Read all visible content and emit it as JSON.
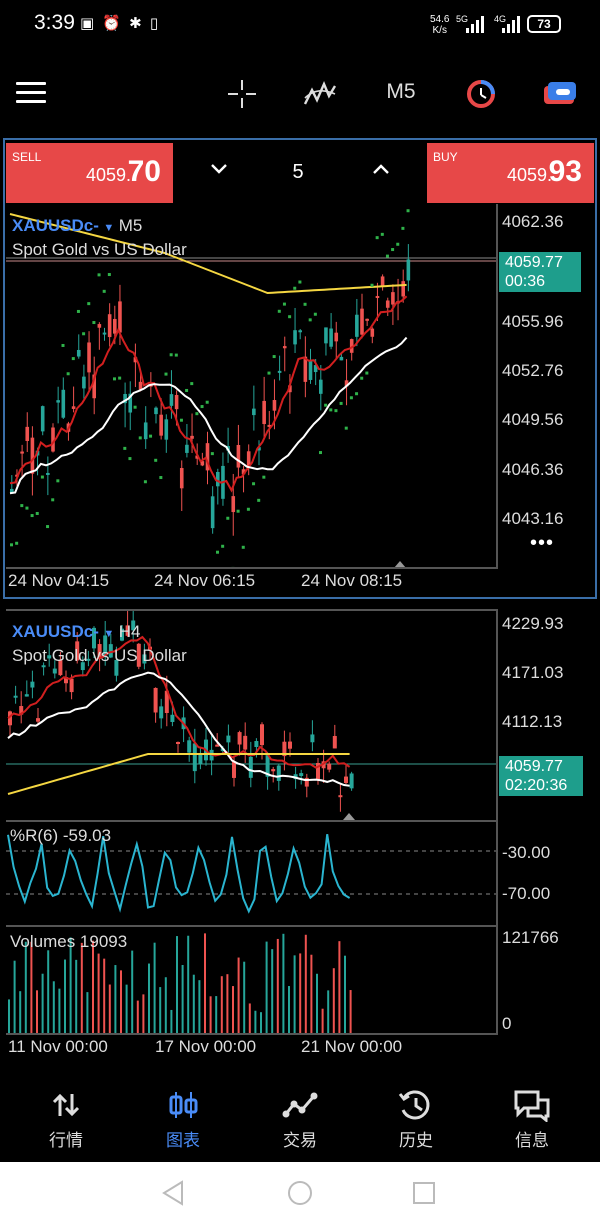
{
  "status_bar": {
    "time": "3:39",
    "net_speed_value": "54.6",
    "net_speed_unit": "K/s",
    "battery": "73",
    "signal": "5G",
    "signal2": "4G"
  },
  "toolbar": {
    "timeframe": "M5"
  },
  "trade_panel": {
    "sell_label": "SELL",
    "sell_price_small": "4059.",
    "sell_price_big": "70",
    "buy_label": "BUY",
    "buy_price_small": "4059.",
    "buy_price_big": "93",
    "lot_value": "5"
  },
  "main_chart": {
    "symbol": "XAUUSDc-",
    "timeframe": "M5",
    "description": "Spot Gold vs US Dollar",
    "price_labels": [
      "4062.36",
      "4055.96",
      "4052.76",
      "4049.56",
      "4046.36",
      "4043.16"
    ],
    "current_price": "4059.77",
    "countdown": "00:36",
    "time_labels": [
      "24 Nov 04:15",
      "24 Nov 06:15",
      "24 Nov 08:15"
    ],
    "more": "•••"
  },
  "lower_chart": {
    "symbol": "XAUUSDc-",
    "timeframe": "H4",
    "description": "Spot Gold vs US Dollar",
    "price_labels": [
      "4229.93",
      "4171.03",
      "4112.13"
    ],
    "current_price": "4059.77",
    "countdown": "02:20:36",
    "wpr_label": "%R(6) -59.03",
    "wpr_levels": [
      "-30.00",
      "-70.00"
    ],
    "volumes_label": "Volumes 19093",
    "volume_levels": [
      "121766",
      "0"
    ],
    "time_labels": [
      "11 Nov 00:00",
      "17 Nov 00:00",
      "21 Nov 00:00"
    ]
  },
  "bottom_nav": {
    "items": [
      {
        "label": "行情",
        "icon": "quotes-icon"
      },
      {
        "label": "图表",
        "icon": "chart-icon"
      },
      {
        "label": "交易",
        "icon": "trade-icon"
      },
      {
        "label": "历史",
        "icon": "history-icon"
      },
      {
        "label": "信息",
        "icon": "messages-icon"
      }
    ],
    "active_index": 1
  },
  "colors": {
    "sell_buy": "#e74848",
    "price_tag": "#1e9e8c",
    "symbol": "#4a8cf7",
    "bull": "#26a69a",
    "bear": "#ef5350",
    "ma_white": "#ffffff",
    "ma_yellow": "#f5d742",
    "ma_red": "#d21f1f",
    "sar": "#2fb24a",
    "wpr": "#2ab5d0"
  }
}
